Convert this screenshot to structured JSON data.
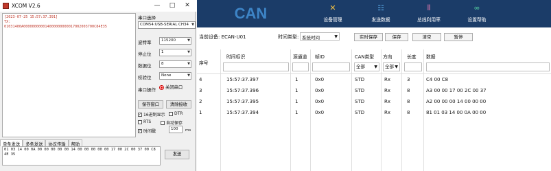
{
  "xcom": {
    "title": "XCOM V2.6",
    "window_buttons": {
      "minimize": "—",
      "maximize": "□",
      "close": "✕"
    },
    "receive_lines": [
      "[2023-07-25 15:57:37.391]",
      "TX:",
      "01031400A000000000014000000000017002003700C84E35"
    ],
    "port_select_label": "串口选择",
    "port_value": "COM54:USB-SERIAL CH34",
    "baud_label": "波特率",
    "baud_value": "115200",
    "stopbit_label": "停止位",
    "stopbit_value": "1",
    "databit_label": "数据位",
    "databit_value": "8",
    "parity_label": "校验位",
    "parity_value": "None",
    "port_op_label": "串口操作",
    "close_port_label": "关闭串口",
    "save_window_label": "保存窗口",
    "clear_recv_label": "清除接收",
    "hex_display_label": "16进制显示",
    "dtr_label": "DTR",
    "rts_label": "RTS",
    "autosave_label": "自动保存",
    "timestamp_label": "时间戳",
    "timestamp_value": "100",
    "timestamp_unit": "ms",
    "tabs": [
      "单条发送",
      "多条发送",
      "协议传输",
      "帮助"
    ],
    "send_text": "01 03 14 00 0A 00 00 00 00 00 14 00 00 00 00 00 17 00 2C 00 37 00 C8 4E 35",
    "send_label": "发送"
  },
  "can": {
    "logo": "CAN",
    "nav": [
      {
        "icon": "✕",
        "label": "设备管理"
      },
      {
        "icon": "☷",
        "label": "发送数据"
      },
      {
        "icon": "⫴",
        "label": "总线利用率"
      },
      {
        "icon": "∞",
        "label": "设置帮助"
      }
    ],
    "device_label": "当前设备: ECAN-U01",
    "time_type_label": "时间类型:",
    "time_type_value": "系统时间",
    "buttons": {
      "realtime_save": "实时保存",
      "save": "保存",
      "clear": "清空",
      "pause": "暂停"
    },
    "columns": {
      "seq": "序号",
      "time": "时间标识",
      "channel": "源通道",
      "frame_id": "帧ID",
      "can_type": "CAN类型",
      "direction": "方向",
      "length": "长度",
      "data": "数据"
    },
    "filter_all": "全部",
    "rows": [
      {
        "seq": "4",
        "time": "15:57:37.397",
        "channel": "1",
        "frame_id": "0x0",
        "can_type": "STD",
        "direction": "Rx",
        "length": "3",
        "data": "C4 00 C8"
      },
      {
        "seq": "3",
        "time": "15:57:37.396",
        "channel": "1",
        "frame_id": "0x0",
        "can_type": "STD",
        "direction": "Rx",
        "length": "8",
        "data": "A3 00 00 17 00 2C 00 37"
      },
      {
        "seq": "2",
        "time": "15:57:37.395",
        "channel": "1",
        "frame_id": "0x0",
        "can_type": "STD",
        "direction": "Rx",
        "length": "8",
        "data": "A2 00 00 00 14 00 00 00"
      },
      {
        "seq": "1",
        "time": "15:57:37.394",
        "channel": "1",
        "frame_id": "0x0",
        "can_type": "STD",
        "direction": "Rx",
        "length": "8",
        "data": "81 01 03 14 00 0A 00 00"
      }
    ]
  }
}
